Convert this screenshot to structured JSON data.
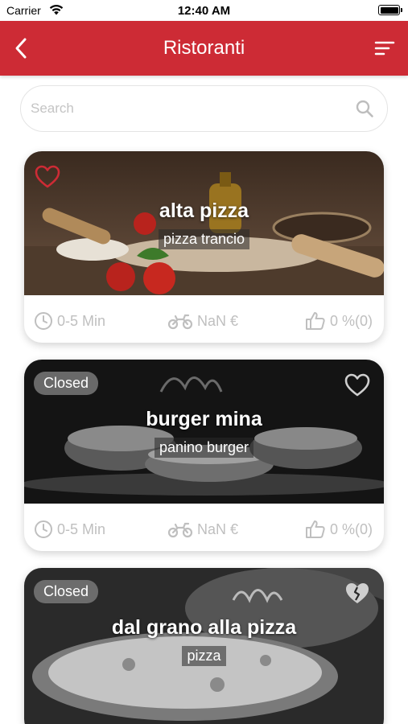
{
  "status_bar": {
    "carrier": "Carrier",
    "time": "12:40 AM"
  },
  "nav": {
    "title": "Ristoranti"
  },
  "search": {
    "placeholder": "Search"
  },
  "colors": {
    "primary": "#cd2b35",
    "muted": "#bfbfbf",
    "favorite": "#cd2b35"
  },
  "restaurants": [
    {
      "name": "alta pizza",
      "category": "pizza trancio",
      "closed": false,
      "closed_label": "",
      "delivery_time": "0-5 Min",
      "delivery_cost": "NaN €",
      "rating": "0 %(0)",
      "favorite_icon": "heart-outline-icon"
    },
    {
      "name": "burger mina",
      "category": "panino burger",
      "closed": true,
      "closed_label": "Closed",
      "delivery_time": "0-5 Min",
      "delivery_cost": "NaN €",
      "rating": "0 %(0)",
      "favorite_icon": "heart-outline-icon"
    },
    {
      "name": "dal grano alla pizza",
      "category": "pizza",
      "closed": true,
      "closed_label": "Closed",
      "favorite_icon": "broken-heart-icon"
    }
  ]
}
